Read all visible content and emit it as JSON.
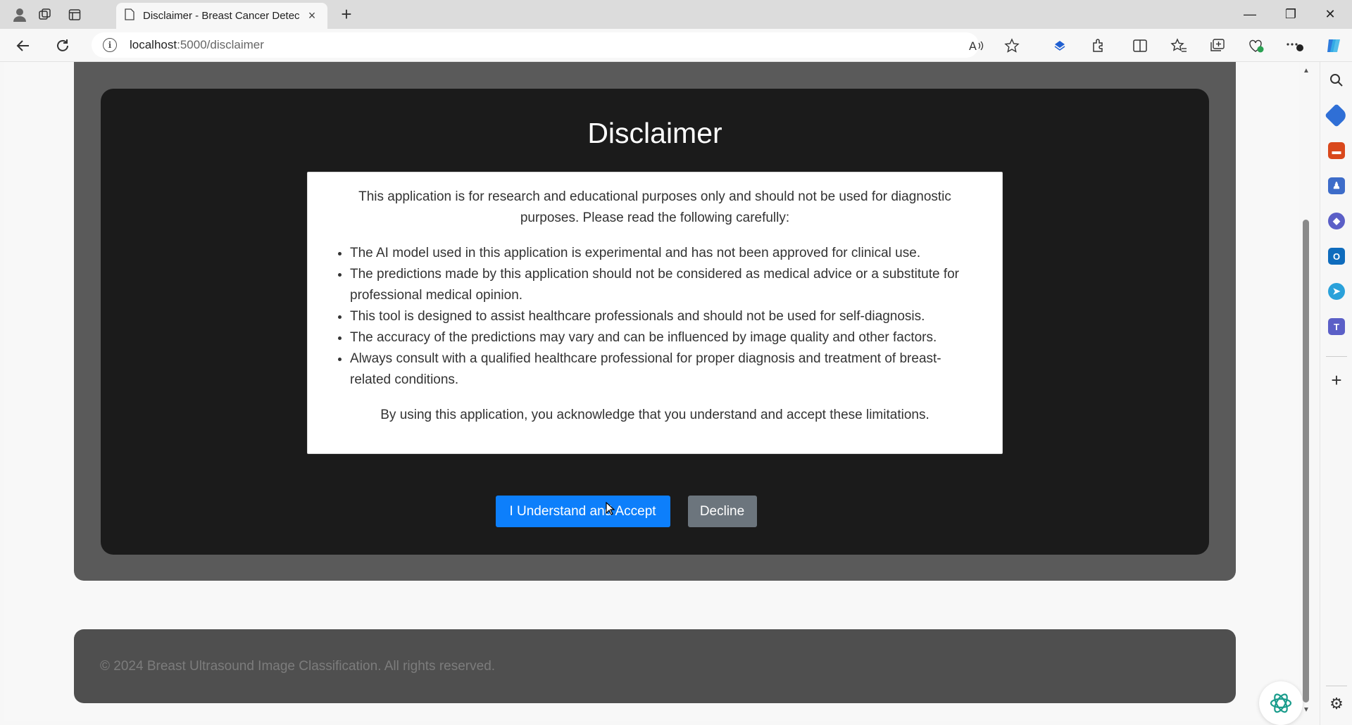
{
  "browser": {
    "tab_title": "Disclaimer - Breast Cancer Detec",
    "url_host": "localhost",
    "url_path": ":5000/disclaimer",
    "new_tab_symbol": "+",
    "close_tab_symbol": "×",
    "window_controls": {
      "minimize": "—",
      "restore": "❐",
      "close": "✕"
    },
    "icons": [
      "profile-icon",
      "workspaces-icon",
      "vertical-tabs-icon",
      "page-icon",
      "back-icon",
      "refresh-icon",
      "info-icon",
      "read-aloud-icon",
      "favorite-star-icon",
      "browser-essentials-icon",
      "extensions-icon",
      "split-screen-icon",
      "favorites-icon",
      "collections-icon",
      "performance-icon",
      "more-options-icon",
      "copilot-icon"
    ]
  },
  "sidebar": {
    "icons": [
      "search-icon",
      "shopping-tag-icon",
      "tools-icon",
      "games-icon",
      "microsoft365-icon",
      "outlook-icon",
      "telegram-icon",
      "teams-icon",
      "add-icon",
      "settings-icon"
    ],
    "colors": {
      "shopping": "#2f6fd6",
      "tools": "#d9481c",
      "games": "#3d6cc9",
      "m365": "#5b5fc7",
      "outlook": "#0f6cbd",
      "telegram": "#2aa1da",
      "teams": "#5b5fc7"
    }
  },
  "page": {
    "heading": "Disclaimer",
    "intro": "This application is for research and educational purposes only and should not be used for diagnostic purposes. Please read the following carefully:",
    "points": [
      "The AI model used in this application is experimental and has not been approved for clinical use.",
      "The predictions made by this application should not be considered as medical advice or a substitute for professional medical opinion.",
      "This tool is designed to assist healthcare professionals and should not be used for self-diagnosis.",
      "The accuracy of the predictions may vary and can be influenced by image quality and other factors.",
      "Always consult with a qualified healthcare professional for proper diagnosis and treatment of breast-related conditions."
    ],
    "outro": "By using this application, you acknowledge that you understand and accept these limitations.",
    "accept_label": "I Understand and Accept",
    "decline_label": "Decline",
    "colors": {
      "accept": "#0d7ffb",
      "decline": "#6c757d",
      "card": "#1b1b1b",
      "panel": "#5a5a5a"
    }
  },
  "footer": {
    "text": "© 2024 Breast Ultrasound Image Classification. All rights reserved."
  }
}
